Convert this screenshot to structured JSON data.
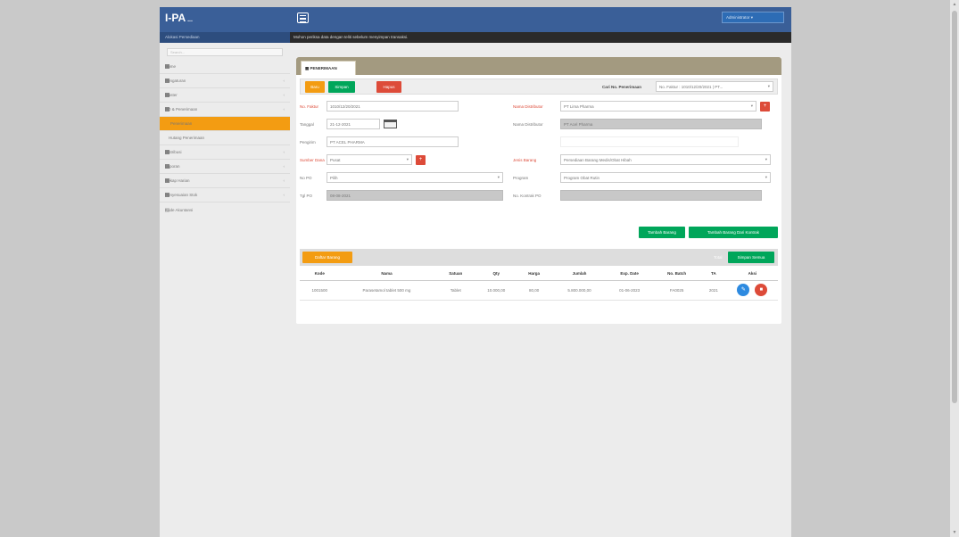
{
  "app": {
    "brand": "I-PA",
    "brand_dots": "...",
    "brand_sub": "Alokasi Persediaan"
  },
  "sidebar": {
    "search_placeholder": "Search...",
    "items": [
      {
        "label": "Home",
        "chev": ""
      },
      {
        "label": "Pengaturan",
        "chev": "‹"
      },
      {
        "label": "Master",
        "chev": "‹"
      },
      {
        "label": "PO & Penerimaan",
        "chev": "‹"
      },
      {
        "label": "Penerimaan",
        "chev": ""
      },
      {
        "label": "Hutang Penerimaan",
        "chev": ""
      },
      {
        "label": "Distribusi",
        "chev": "‹"
      },
      {
        "label": "Laporan",
        "chev": "‹"
      },
      {
        "label": "Rekap Harian",
        "chev": "‹"
      },
      {
        "label": "Penyesuaian Stok",
        "chev": "‹"
      },
      {
        "label": "Kode Akuntansi",
        "chev": ""
      }
    ]
  },
  "topbar": {
    "user_label": "Administrator",
    "notice": "Mohon periksa data dengan teliti sebelum menyimpan transaksi."
  },
  "panel": {
    "tab_label": "PENERIMAAN",
    "actions": {
      "new_label": "Baru",
      "save_label": "Simpan",
      "delete_label": "Hapus",
      "search_label": "Cari No. Penerimaan",
      "search_value": "No. Faktur : 1010/12/20/2021 | PT..."
    },
    "form": {
      "faktur_label": "No. Faktur",
      "faktur_value": "1010/12/20/2021",
      "tanggal_label": "Tanggal",
      "tanggal_value": "21-12-2021",
      "pengirim_label": "Pengirim",
      "pengirim_value": "PT ACEL PHARMA",
      "sumber_label": "Sumber Dana",
      "sumber_value": "Pusat",
      "nopo_label": "No PO",
      "nopo_value": "Pilih",
      "tgl_po_label": "Tgl PO",
      "tgl_po_value": "08-08-2021",
      "distributor_label": "Nama Distributor",
      "distributor_value": "PT Lima Pharma",
      "nama_dist_label": "Nama Distributor",
      "nama_dist_value": "PT Acel Pharma",
      "jenis_label": "Jenis Barang",
      "jenis_value": "Persediaan Barang Medis/Obat Hibah",
      "program_label": "Program",
      "program_value": "Program Obat Rutin",
      "kontrak_label": "No. Kontrak PO",
      "kontrak_value": ""
    },
    "table_actions": {
      "btn1": "Tambah Barang",
      "btn2": "Tambah Barang Dari Kontrak",
      "list_title": "Daftar Barang",
      "small_label": "Total",
      "btn3": "Simpan Semua"
    },
    "table": {
      "headers": [
        "Kode",
        "Nama",
        "Satuan",
        "Qty",
        "Harga",
        "Jumlah",
        "Exp. Date",
        "No. Batch",
        "TA",
        "Aksi"
      ],
      "rows": [
        [
          "1001500",
          "Parasetamol tablet 500 mg",
          "Tablet",
          "10.000,00",
          "80,00",
          "5.800.000,00",
          "01-06-2023",
          "FA0025",
          "2021"
        ]
      ]
    }
  },
  "icons": [
    "menu-icon",
    "calendar-icon",
    "plus-icon",
    "edit-icon",
    "trash-icon"
  ],
  "colors": {
    "primary": "#3a5f98",
    "accent": "#f39c12",
    "success": "#00a65a",
    "danger": "#dd4b39"
  }
}
